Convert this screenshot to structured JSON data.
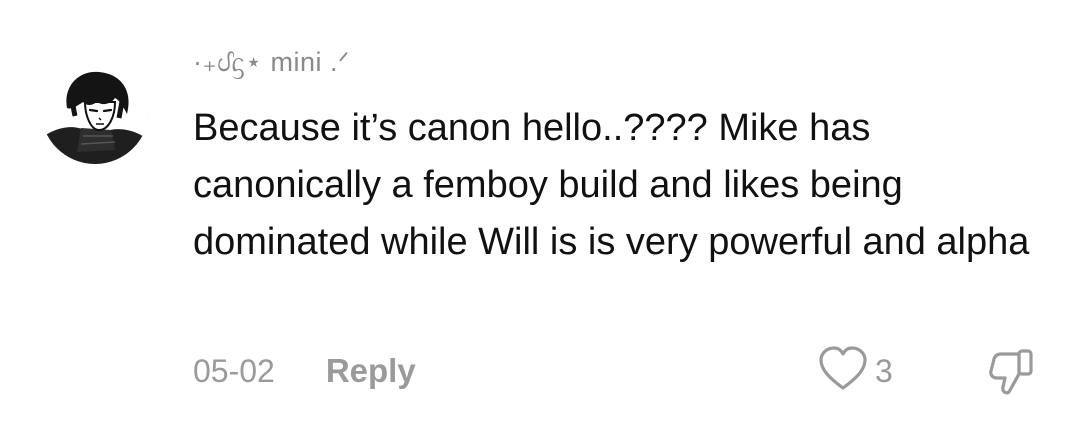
{
  "comment": {
    "username": "·₊ᦔᦓ⋆ mini  .ᐟ",
    "text": "Because it’s canon hello..???? Mike has canonically a femboy build and likes being dominated while Will is is very powerful and alpha",
    "date": "05-02",
    "reply_label": "Reply",
    "like_count": "3"
  },
  "icons": {
    "like": "heart-outline-icon",
    "dislike": "thumbs-down-outline-icon"
  },
  "colors": {
    "text": "#111111",
    "muted": "#9a9a9a"
  }
}
